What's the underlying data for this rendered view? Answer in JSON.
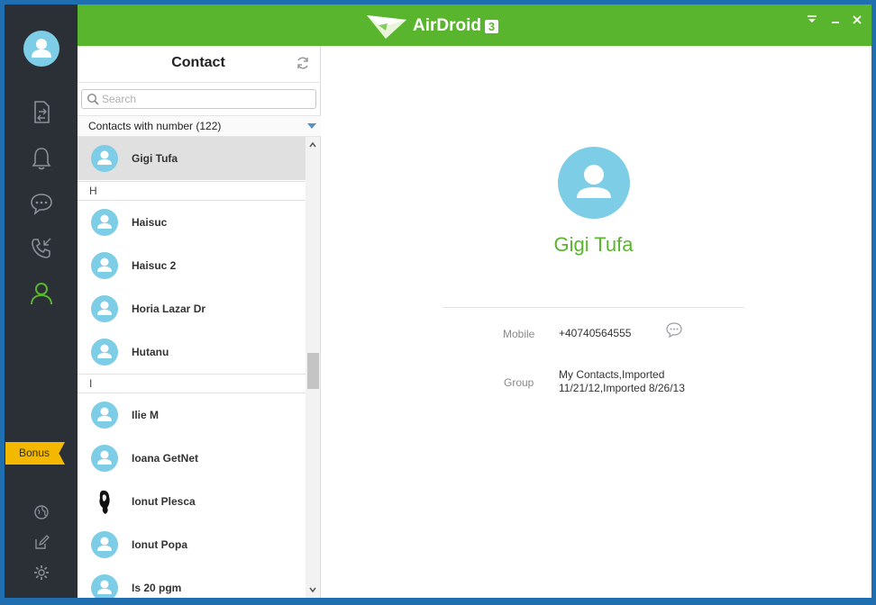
{
  "app": {
    "title": "AirDroid",
    "version_badge": "3",
    "brand_color": "#5ab52e"
  },
  "rail": {
    "icons": [
      "user-avatar-icon",
      "file-transfer-icon",
      "notification-bell-icon",
      "messages-icon",
      "call-log-icon",
      "contacts-icon"
    ],
    "active": "contacts-icon",
    "bonus_label": "Bonus",
    "bottom_icons": [
      "globe-icon",
      "edit-icon",
      "settings-gear-icon"
    ]
  },
  "contacts_panel": {
    "title": "Contact",
    "search_placeholder": "Search",
    "filter_label": "Contacts with number (122)",
    "rows": [
      {
        "type": "contact",
        "name": "Gigi Tufa",
        "selected": true
      },
      {
        "type": "section",
        "name": "H"
      },
      {
        "type": "contact",
        "name": "Haisuc"
      },
      {
        "type": "contact",
        "name": "Haisuc 2"
      },
      {
        "type": "contact",
        "name": "Horia Lazar Dr"
      },
      {
        "type": "contact",
        "name": "Hutanu"
      },
      {
        "type": "section",
        "name": "I"
      },
      {
        "type": "contact",
        "name": "Ilie M"
      },
      {
        "type": "contact",
        "name": "Ioana GetNet"
      },
      {
        "type": "contact",
        "name": "Ionut Plesca",
        "photo": true
      },
      {
        "type": "contact",
        "name": "Ionut Popa"
      },
      {
        "type": "contact",
        "name": "Is 20 pgm"
      }
    ]
  },
  "detail": {
    "name": "Gigi Tufa",
    "mobile_label": "Mobile",
    "mobile_value": "+40740564555",
    "group_label": "Group",
    "group_value_line1": "My Contacts,Imported",
    "group_value_line2": "11/21/12,Imported 8/26/13"
  }
}
